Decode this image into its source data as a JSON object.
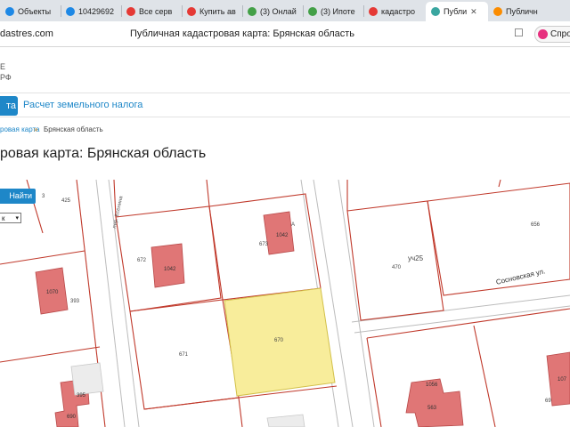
{
  "browser": {
    "tabs": [
      {
        "label": "Объекты",
        "color": "#1e88e5"
      },
      {
        "label": "10429692",
        "color": "#1e88e5"
      },
      {
        "label": "Все серв",
        "color": "#e53935"
      },
      {
        "label": "Купить ав",
        "color": "#e53935"
      },
      {
        "label": "(3) Онлай",
        "color": "#43a047"
      },
      {
        "label": "(3) Ипоте",
        "color": "#43a047"
      },
      {
        "label": "кадастро",
        "color": "#e53935"
      },
      {
        "label": "Публи",
        "color": "#3aa6a0"
      },
      {
        "label": "Публичн",
        "color": "#fb8c00"
      }
    ],
    "active_tab_close": "✕",
    "url": "dastres.com",
    "page_title": "Публичная кадастровая карта: Брянская область",
    "bookmark_icon": "☐",
    "profile_label": "Спро"
  },
  "site": {
    "logo_line1": "E",
    "logo_line2": "РФ",
    "nav_active": "та",
    "nav_tax": "Расчет земельного налога",
    "breadcrumb_link": "ровая карта",
    "breadcrumb_sep": "»",
    "breadcrumb_current": "Брянская область",
    "heading": "ровая карта: Брянская область"
  },
  "map": {
    "search_label": "Найти",
    "select_value": "к",
    "select_chevron": "▾",
    "street_name": "Сосновская ул.",
    "street_name2": "пер. Есенина",
    "parcels": [
      {
        "label": "425"
      },
      {
        "label": "3"
      },
      {
        "label": "672"
      },
      {
        "label": "673"
      },
      {
        "label": "А"
      },
      {
        "label": "470"
      },
      {
        "label": "уч25"
      },
      {
        "label": "656"
      },
      {
        "label": "393"
      },
      {
        "label": "671"
      },
      {
        "label": "670"
      },
      {
        "label": "69"
      }
    ],
    "buildings": [
      {
        "label": "1042"
      },
      {
        "label": "1042"
      },
      {
        "label": "1070"
      },
      {
        "label": "395"
      },
      {
        "label": "690"
      },
      {
        "label": "1056"
      },
      {
        "label": "563"
      },
      {
        "label": "107"
      }
    ],
    "colors": {
      "parcel_border": "#c0392b",
      "building_fill": "#e07676",
      "selected_fill": "#f8ed9b",
      "selected_stroke": "#d2c049",
      "road_line": "#bcbcbc"
    }
  }
}
